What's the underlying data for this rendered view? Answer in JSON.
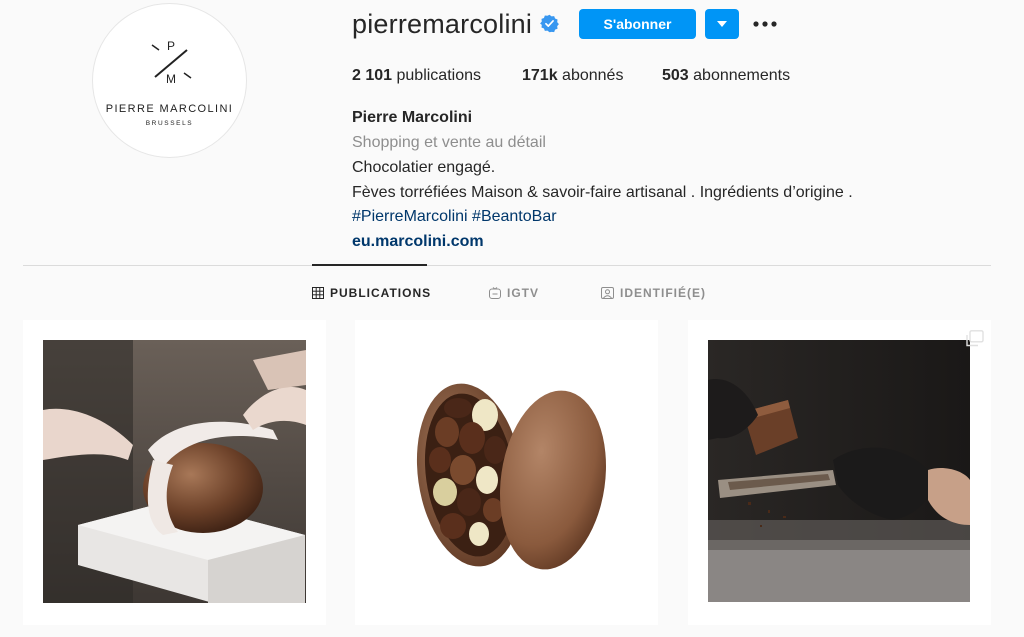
{
  "profile": {
    "username": "pierremarcolini",
    "verified": true,
    "avatar": {
      "brand_name": "PIERRE MARCOLINI",
      "brand_city": "BRUSSELS",
      "monogram_top": "P",
      "monogram_bottom": "M"
    },
    "follow_label": "S'abonner",
    "stats": {
      "posts_count": "2 101",
      "posts_label": "publications",
      "followers_count": "171k",
      "followers_label": "abonnés",
      "following_count": "503",
      "following_label": "abonnements"
    },
    "bio": {
      "full_name": "Pierre Marcolini",
      "category": "Shopping et vente au détail",
      "line1": "Chocolatier engagé.",
      "line2": "Fèves torréfiées Maison & savoir-faire artisanal . Ingrédients d’origine .",
      "hashtags": "#PierreMarcolini #BeantoBar",
      "link": "eu.marcolini.com"
    }
  },
  "tabs": [
    {
      "label": "PUBLICATIONS",
      "icon": "grid-icon",
      "active": true
    },
    {
      "label": "IGTV",
      "icon": "igtv-icon",
      "active": false
    },
    {
      "label": "IDENTIFIÉ(E)",
      "icon": "tagged-icon",
      "active": false
    }
  ],
  "posts": [
    {
      "icon": "photo",
      "subject": "chocolate-egg-with-ribbon"
    },
    {
      "icon": "photo",
      "subject": "open-chocolate-egg-with-mini-eggs"
    },
    {
      "icon": "multi-photo-icon",
      "subject": "chocolate-grating-gloved-hands"
    }
  ],
  "colors": {
    "accent": "#0095f6",
    "link": "#00376b",
    "muted": "#8e8e8e",
    "text": "#262626"
  }
}
